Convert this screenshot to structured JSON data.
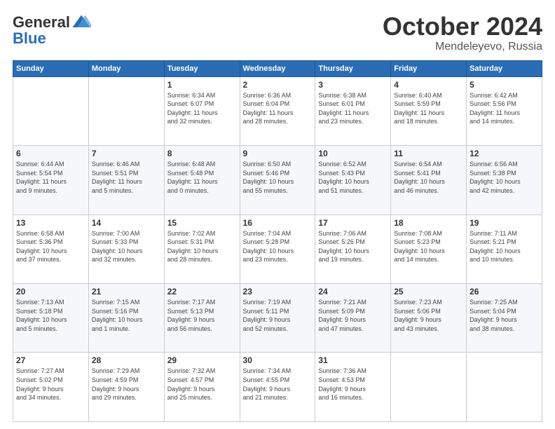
{
  "logo": {
    "general": "General",
    "blue": "Blue"
  },
  "header": {
    "title": "October 2024",
    "subtitle": "Mendeleyevo, Russia"
  },
  "days_of_week": [
    "Sunday",
    "Monday",
    "Tuesday",
    "Wednesday",
    "Thursday",
    "Friday",
    "Saturday"
  ],
  "weeks": [
    [
      {
        "day": "",
        "info": ""
      },
      {
        "day": "",
        "info": ""
      },
      {
        "day": "1",
        "info": "Sunrise: 6:34 AM\nSunset: 6:07 PM\nDaylight: 11 hours\nand 32 minutes."
      },
      {
        "day": "2",
        "info": "Sunrise: 6:36 AM\nSunset: 6:04 PM\nDaylight: 11 hours\nand 28 minutes."
      },
      {
        "day": "3",
        "info": "Sunrise: 6:38 AM\nSunset: 6:01 PM\nDaylight: 11 hours\nand 23 minutes."
      },
      {
        "day": "4",
        "info": "Sunrise: 6:40 AM\nSunset: 5:59 PM\nDaylight: 11 hours\nand 18 minutes."
      },
      {
        "day": "5",
        "info": "Sunrise: 6:42 AM\nSunset: 5:56 PM\nDaylight: 11 hours\nand 14 minutes."
      }
    ],
    [
      {
        "day": "6",
        "info": "Sunrise: 6:44 AM\nSunset: 5:54 PM\nDaylight: 11 hours\nand 9 minutes."
      },
      {
        "day": "7",
        "info": "Sunrise: 6:46 AM\nSunset: 5:51 PM\nDaylight: 11 hours\nand 5 minutes."
      },
      {
        "day": "8",
        "info": "Sunrise: 6:48 AM\nSunset: 5:48 PM\nDaylight: 11 hours\nand 0 minutes."
      },
      {
        "day": "9",
        "info": "Sunrise: 6:50 AM\nSunset: 5:46 PM\nDaylight: 10 hours\nand 55 minutes."
      },
      {
        "day": "10",
        "info": "Sunrise: 6:52 AM\nSunset: 5:43 PM\nDaylight: 10 hours\nand 51 minutes."
      },
      {
        "day": "11",
        "info": "Sunrise: 6:54 AM\nSunset: 5:41 PM\nDaylight: 10 hours\nand 46 minutes."
      },
      {
        "day": "12",
        "info": "Sunrise: 6:56 AM\nSunset: 5:38 PM\nDaylight: 10 hours\nand 42 minutes."
      }
    ],
    [
      {
        "day": "13",
        "info": "Sunrise: 6:58 AM\nSunset: 5:36 PM\nDaylight: 10 hours\nand 37 minutes."
      },
      {
        "day": "14",
        "info": "Sunrise: 7:00 AM\nSunset: 5:33 PM\nDaylight: 10 hours\nand 32 minutes."
      },
      {
        "day": "15",
        "info": "Sunrise: 7:02 AM\nSunset: 5:31 PM\nDaylight: 10 hours\nand 28 minutes."
      },
      {
        "day": "16",
        "info": "Sunrise: 7:04 AM\nSunset: 5:28 PM\nDaylight: 10 hours\nand 23 minutes."
      },
      {
        "day": "17",
        "info": "Sunrise: 7:06 AM\nSunset: 5:26 PM\nDaylight: 10 hours\nand 19 minutes."
      },
      {
        "day": "18",
        "info": "Sunrise: 7:08 AM\nSunset: 5:23 PM\nDaylight: 10 hours\nand 14 minutes."
      },
      {
        "day": "19",
        "info": "Sunrise: 7:11 AM\nSunset: 5:21 PM\nDaylight: 10 hours\nand 10 minutes."
      }
    ],
    [
      {
        "day": "20",
        "info": "Sunrise: 7:13 AM\nSunset: 5:18 PM\nDaylight: 10 hours\nand 5 minutes."
      },
      {
        "day": "21",
        "info": "Sunrise: 7:15 AM\nSunset: 5:16 PM\nDaylight: 10 hours\nand 1 minute."
      },
      {
        "day": "22",
        "info": "Sunrise: 7:17 AM\nSunset: 5:13 PM\nDaylight: 9 hours\nand 56 minutes."
      },
      {
        "day": "23",
        "info": "Sunrise: 7:19 AM\nSunset: 5:11 PM\nDaylight: 9 hours\nand 52 minutes."
      },
      {
        "day": "24",
        "info": "Sunrise: 7:21 AM\nSunset: 5:09 PM\nDaylight: 9 hours\nand 47 minutes."
      },
      {
        "day": "25",
        "info": "Sunrise: 7:23 AM\nSunset: 5:06 PM\nDaylight: 9 hours\nand 43 minutes."
      },
      {
        "day": "26",
        "info": "Sunrise: 7:25 AM\nSunset: 5:04 PM\nDaylight: 9 hours\nand 38 minutes."
      }
    ],
    [
      {
        "day": "27",
        "info": "Sunrise: 7:27 AM\nSunset: 5:02 PM\nDaylight: 9 hours\nand 34 minutes."
      },
      {
        "day": "28",
        "info": "Sunrise: 7:29 AM\nSunset: 4:59 PM\nDaylight: 9 hours\nand 29 minutes."
      },
      {
        "day": "29",
        "info": "Sunrise: 7:32 AM\nSunset: 4:57 PM\nDaylight: 9 hours\nand 25 minutes."
      },
      {
        "day": "30",
        "info": "Sunrise: 7:34 AM\nSunset: 4:55 PM\nDaylight: 9 hours\nand 21 minutes."
      },
      {
        "day": "31",
        "info": "Sunrise: 7:36 AM\nSunset: 4:53 PM\nDaylight: 9 hours\nand 16 minutes."
      },
      {
        "day": "",
        "info": ""
      },
      {
        "day": "",
        "info": ""
      }
    ]
  ]
}
